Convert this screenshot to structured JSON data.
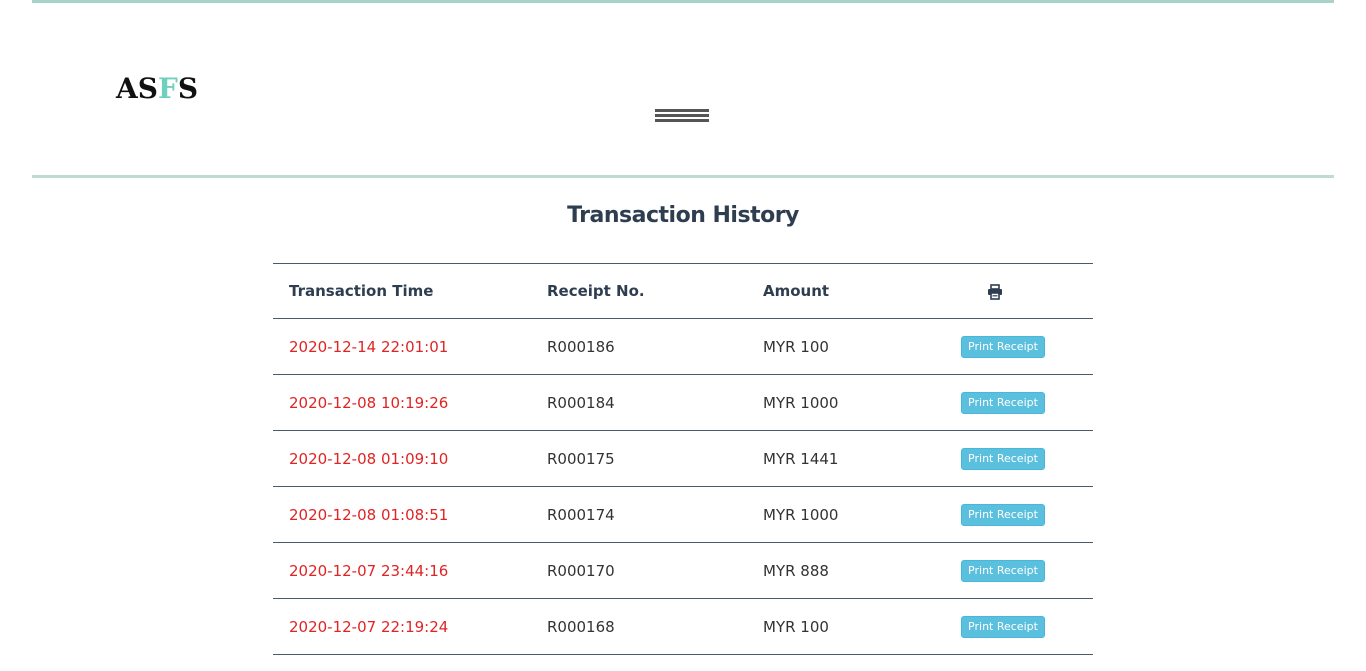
{
  "header": {
    "logo": {
      "part1": "AS",
      "accent": "F",
      "part2": "S"
    }
  },
  "page": {
    "title": "Transaction History"
  },
  "table": {
    "columns": [
      "Transaction Time",
      "Receipt No.",
      "Amount"
    ],
    "print_column_icon": "printer-icon",
    "rows": [
      {
        "time": "2020-12-14 22:01:01",
        "receipt": "R000186",
        "amount": "MYR 100",
        "action": "Print Receipt"
      },
      {
        "time": "2020-12-08 10:19:26",
        "receipt": "R000184",
        "amount": "MYR 1000",
        "action": "Print Receipt"
      },
      {
        "time": "2020-12-08 01:09:10",
        "receipt": "R000175",
        "amount": "MYR 1441",
        "action": "Print Receipt"
      },
      {
        "time": "2020-12-08 01:08:51",
        "receipt": "R000174",
        "amount": "MYR 1000",
        "action": "Print Receipt"
      },
      {
        "time": "2020-12-07 23:44:16",
        "receipt": "R000170",
        "amount": "MYR 888",
        "action": "Print Receipt"
      },
      {
        "time": "2020-12-07 22:19:24",
        "receipt": "R000168",
        "amount": "MYR 100",
        "action": "Print Receipt"
      }
    ]
  },
  "colors": {
    "accent": "#6fd1bd",
    "rule": "#a9d3c9",
    "title": "#2e3e50",
    "time_text": "#e02424",
    "button": "#5bc0de"
  }
}
